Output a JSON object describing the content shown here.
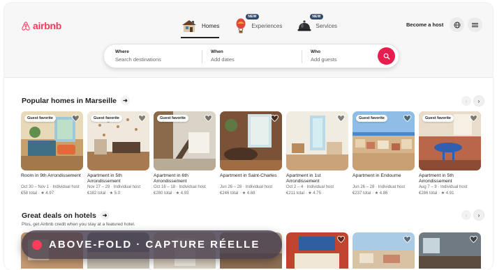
{
  "brand": {
    "name": "airbnb",
    "color": "#FF385C",
    "icon": "airbnb-logo-icon"
  },
  "nav": [
    {
      "label": "Homes",
      "icon": "house-icon",
      "active": true,
      "badge": ""
    },
    {
      "label": "Experiences",
      "icon": "hot-air-balloon-icon",
      "active": false,
      "badge": "NEW"
    },
    {
      "label": "Services",
      "icon": "service-bell-icon",
      "active": false,
      "badge": "NEW"
    }
  ],
  "header": {
    "host_link": "Become a host",
    "globe_icon": "globe-icon",
    "menu_icon": "hamburger-menu-icon"
  },
  "search": {
    "where": {
      "title": "Where",
      "placeholder": "Search destinations"
    },
    "when": {
      "title": "When",
      "placeholder": "Add dates"
    },
    "who": {
      "title": "Who",
      "placeholder": "Add guests"
    },
    "button_color": "#E61E4D",
    "icon": "search-icon"
  },
  "popular": {
    "title": "Popular homes in Marseille",
    "listings": [
      {
        "badge": "Guest favorite",
        "name": "Room in 9th Arrondissement",
        "meta": "Oct 30 – Nov 1 · Individual host",
        "price": "€58 total · ★ 4.97"
      },
      {
        "badge": "Guest favorite",
        "name": "Apartment in 5th Arrondissement",
        "meta": "Nov 27 – 29 · Individual host",
        "price": "€182 total · ★ 5.0"
      },
      {
        "badge": "Guest favorite",
        "name": "Apartment in 6th Arrondissement",
        "meta": "Oct 16 – 18 · Individual host",
        "price": "€280 total · ★ 4.93"
      },
      {
        "badge": "",
        "name": "Apartment in Saint-Charles",
        "meta": "Jun 26 – 28 · Individual host",
        "price": "€246 total · ★ 4.88"
      },
      {
        "badge": "",
        "name": "Apartment in 1st Arrondissement",
        "meta": "Oct 2 – 4 · Individual host",
        "price": "€211 total · ★ 4.75"
      },
      {
        "badge": "Guest favorite",
        "name": "Apartment in Endoume",
        "meta": "Jun 26 – 28 · Individual host",
        "price": "€237 total · ★ 4.86"
      },
      {
        "badge": "Guest favorite",
        "name": "Apartment in 5th Arrondissement",
        "meta": "Aug 7 – 9 · Individual host",
        "price": "€286 total · ★ 4.91"
      }
    ]
  },
  "deals": {
    "title": "Great deals on hotels",
    "subtitle": "Plus, get Airbnb credit when you stay at a featured hotel."
  },
  "overlay": {
    "text": "ABOVE-FOLD · CAPTURE RÉELLE",
    "dot_color": "#FF3B5C"
  }
}
